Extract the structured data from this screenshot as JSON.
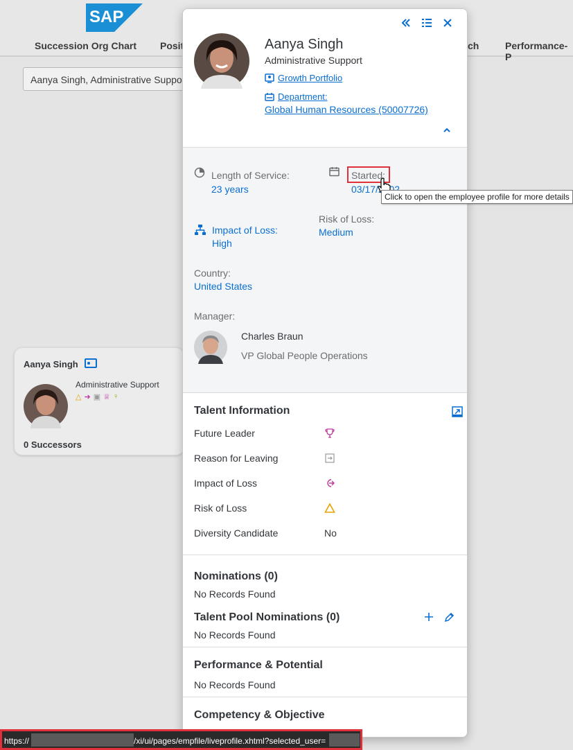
{
  "background": {
    "nav": [
      "Succession Org Chart",
      "Posit",
      "ch",
      "Performance-P"
    ],
    "search_value": "Aanya Singh, Administrative Support",
    "card": {
      "name": "Aanya Singh",
      "role": "Administrative Support",
      "successors": "0 Successors"
    }
  },
  "employee": {
    "name": "Aanya Singh",
    "title": "Administrative Support",
    "growth_portfolio": "Growth Portfolio",
    "department_label": "Department:",
    "department_value": "Global Human Resources (50007726)"
  },
  "details": {
    "length_of_service_label": "Length of Service:",
    "length_of_service_value": "23 years",
    "started_label": "Started:",
    "started_value": "03/17/2002",
    "tooltip": "Click to open the employee profile for more details",
    "impact_of_loss_label": "Impact of Loss:",
    "impact_of_loss_value": "High",
    "risk_of_loss_label": "Risk of Loss:",
    "risk_of_loss_value": "Medium",
    "country_label": "Country:",
    "country_value": "United States",
    "manager_label": "Manager:",
    "manager_name": "Charles Braun",
    "manager_title": "VP Global People Operations"
  },
  "talent": {
    "title": "Talent Information",
    "rows": [
      {
        "label": "Future Leader"
      },
      {
        "label": "Reason for Leaving"
      },
      {
        "label": "Impact of Loss"
      },
      {
        "label": "Risk of Loss"
      },
      {
        "label": "Diversity Candidate",
        "value": "No"
      }
    ]
  },
  "nominations": {
    "title": "Nominations (0)",
    "empty": "No Records Found",
    "pool_title": "Talent Pool Nominations (0)",
    "pool_empty": "No Records Found"
  },
  "performance": {
    "title": "Performance & Potential",
    "empty": "No Records Found"
  },
  "competency": {
    "title": "Competency & Objective"
  },
  "status_bar": {
    "prefix": "https://",
    "path": "/xi/ui/pages/empfile/liveprofile.xhtml?selected_user="
  },
  "colors": {
    "accent": "#0a6ed1",
    "highlight": "#e0303a",
    "future_leader": "#c0399f",
    "risk": "#e9a000"
  }
}
